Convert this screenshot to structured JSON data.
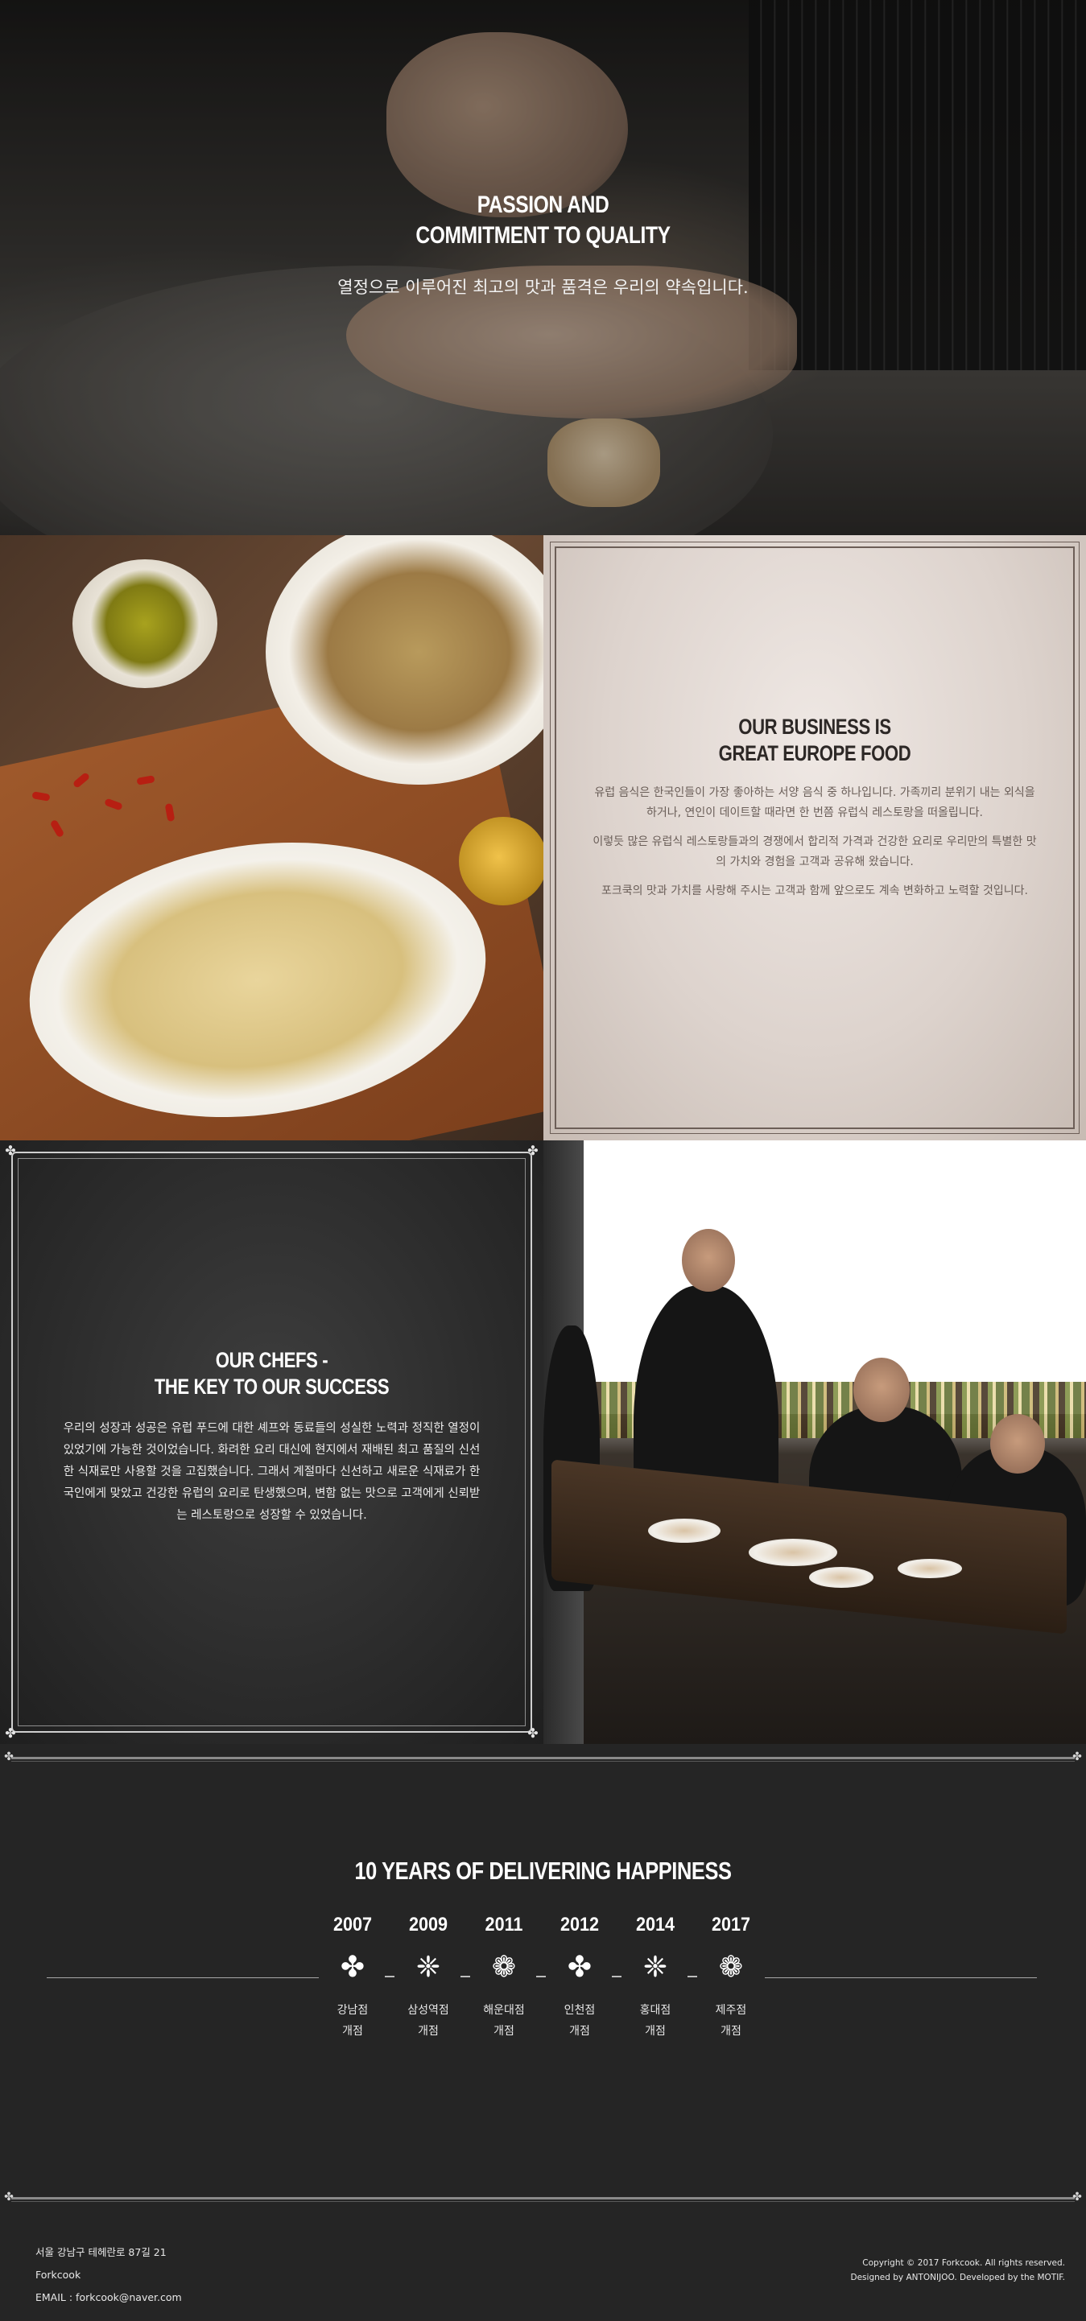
{
  "hero": {
    "title_line1": "PASSION AND",
    "title_line2": "COMMITMENT TO QUALITY",
    "subtitle": "열정으로 이루어진 최고의 맛과 품격은 우리의 약속입니다."
  },
  "business": {
    "title_line1": "OUR BUSINESS IS",
    "title_line2": "GREAT EUROPE FOOD",
    "paragraphs": [
      "유럽 음식은 한국인들이 가장 좋아하는 서양 음식 중 하나입니다. 가족끼리 분위기 내는 외식을 하거나, 연인이 데이트할 때라면 한 번쯤 유럽식 레스토랑을 떠올립니다.",
      "이렇듯 많은 유럽식 레스토랑들과의 경쟁에서 합리적 가격과 건강한 요리로 우리만의 특별한 맛의 가치와 경험을 고객과 공유해 왔습니다.",
      "포크쿡의 맛과 가치를 사랑해 주시는 고객과 함께 앞으로도 계속 변화하고 노력할 것입니다."
    ]
  },
  "chefs": {
    "title_line1": "OUR CHEFS -",
    "title_line2": "THE KEY TO OUR SUCCESS",
    "paragraph": "우리의 성장과 성공은 유럽 푸드에 대한 셰프와 동료들의 성실한 노력과 정직한 열정이 있었기에 가능한 것이었습니다. 화려한 요리 대신에 현지에서 재배된 최고 품질의 신선한 식재료만 사용할 것을 고집했습니다. 그래서 계절마다 신선하고 새로운 식재료가 한국인에게 맞았고 건강한 유럽의 요리로 탄생했으며, 변함 없는 맛으로 고객에게 신뢰받는 레스토랑으로 성장할 수 있었습니다."
  },
  "history": {
    "title": "10 YEARS OF DELIVERING HAPPINESS",
    "items": [
      {
        "year": "2007",
        "icon": "flower-cross-icon",
        "label_line1": "강남점",
        "label_line2": "개점"
      },
      {
        "year": "2009",
        "icon": "flower-burst-icon",
        "label_line1": "삼성역점",
        "label_line2": "개점"
      },
      {
        "year": "2011",
        "icon": "sunflower-icon",
        "label_line1": "해운대점",
        "label_line2": "개점"
      },
      {
        "year": "2012",
        "icon": "flower-cross-icon",
        "label_line1": "인천점",
        "label_line2": "개점"
      },
      {
        "year": "2014",
        "icon": "flower-burst-icon",
        "label_line1": "홍대점",
        "label_line2": "개점"
      },
      {
        "year": "2017",
        "icon": "sunflower-icon",
        "label_line1": "제주점",
        "label_line2": "개점"
      }
    ]
  },
  "footer": {
    "address": "서울 강남구 테헤란로 87길 21",
    "company": "Forkcook",
    "email": "EMAIL : forkcook@naver.com",
    "copyright": "Copyright © 2017 Forkcook. All rights reserved.",
    "credits": "Designed by ANTONIJOO. Developed by the MOTIF."
  }
}
